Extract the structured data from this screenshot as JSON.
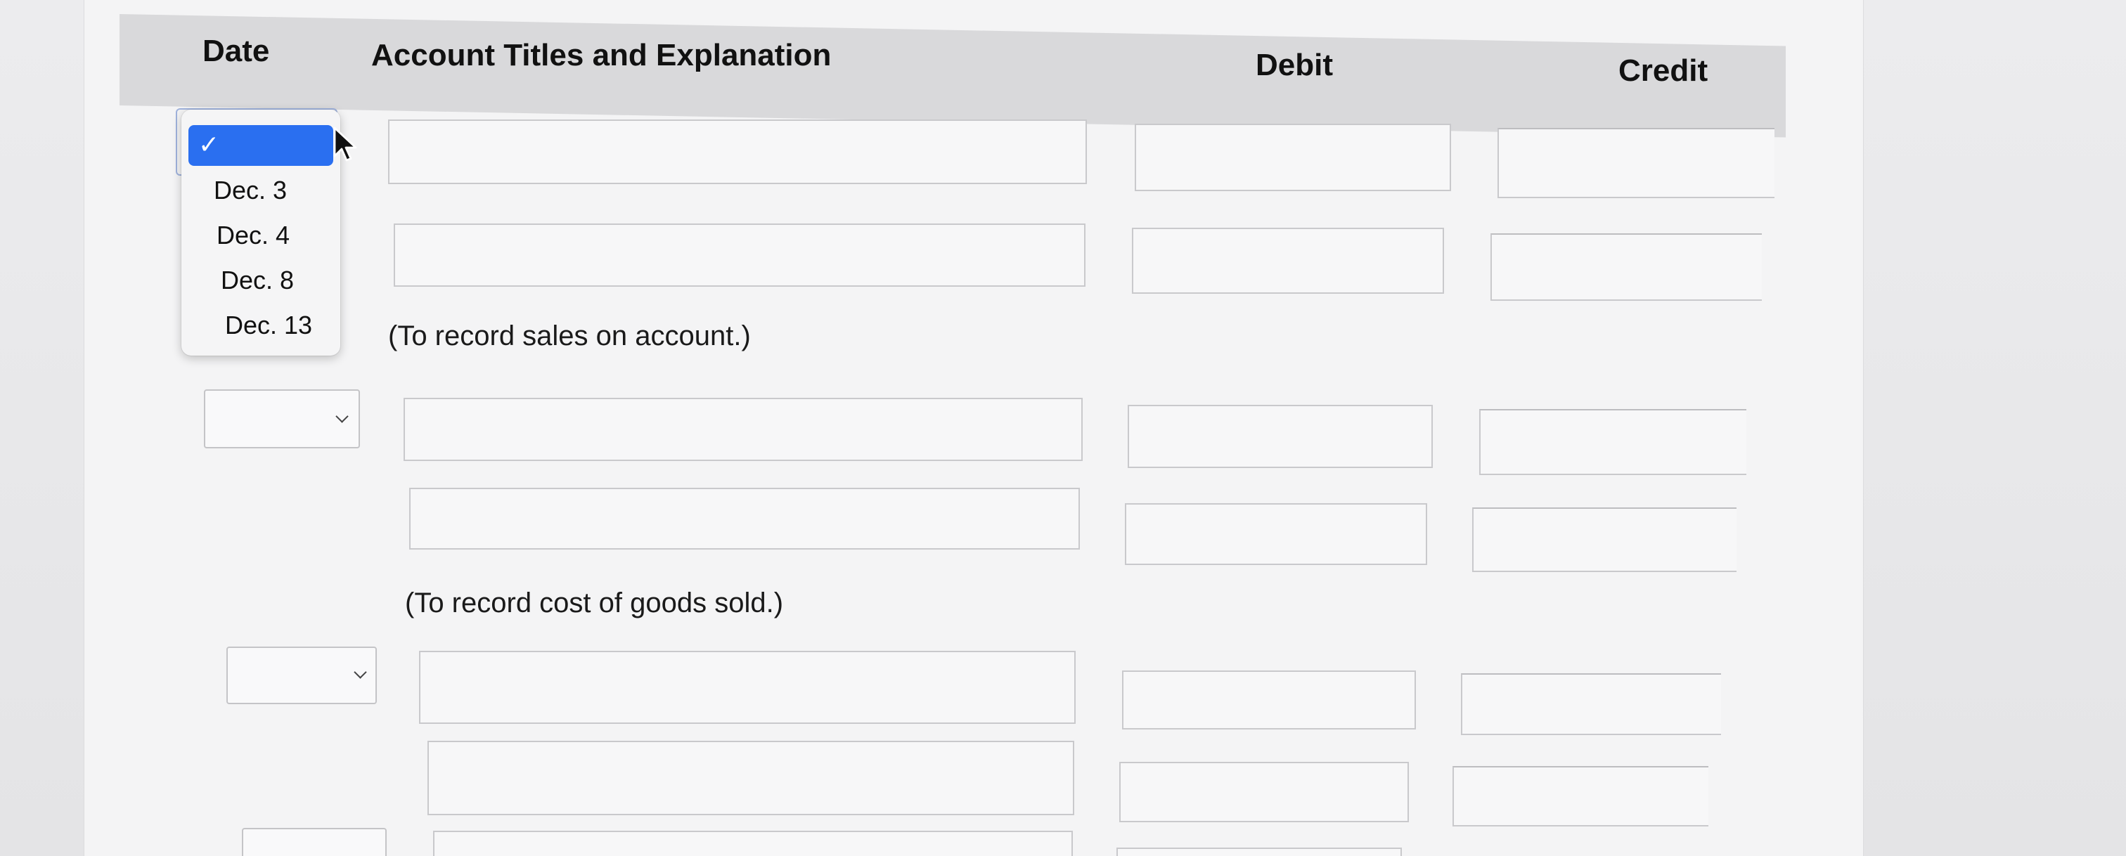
{
  "table": {
    "headers": {
      "date": "Date",
      "account": "Account Titles and Explanation",
      "debit": "Debit",
      "credit": "Credit"
    },
    "notes": [
      "(To record sales on account.)",
      "(To record cost of goods sold.)"
    ]
  },
  "date_dropdown": {
    "selected_value": "",
    "options": [
      "Dec. 3",
      "Dec. 4",
      "Dec. 8",
      "Dec. 13"
    ],
    "check_glyph": "✓"
  },
  "icons": {
    "check": "check-icon",
    "chevron": "chevron-down-icon",
    "cursor": "mouse-pointer-icon"
  },
  "colors": {
    "selection_accent": "#2a6ff0",
    "header_band": "#d9d9db"
  }
}
